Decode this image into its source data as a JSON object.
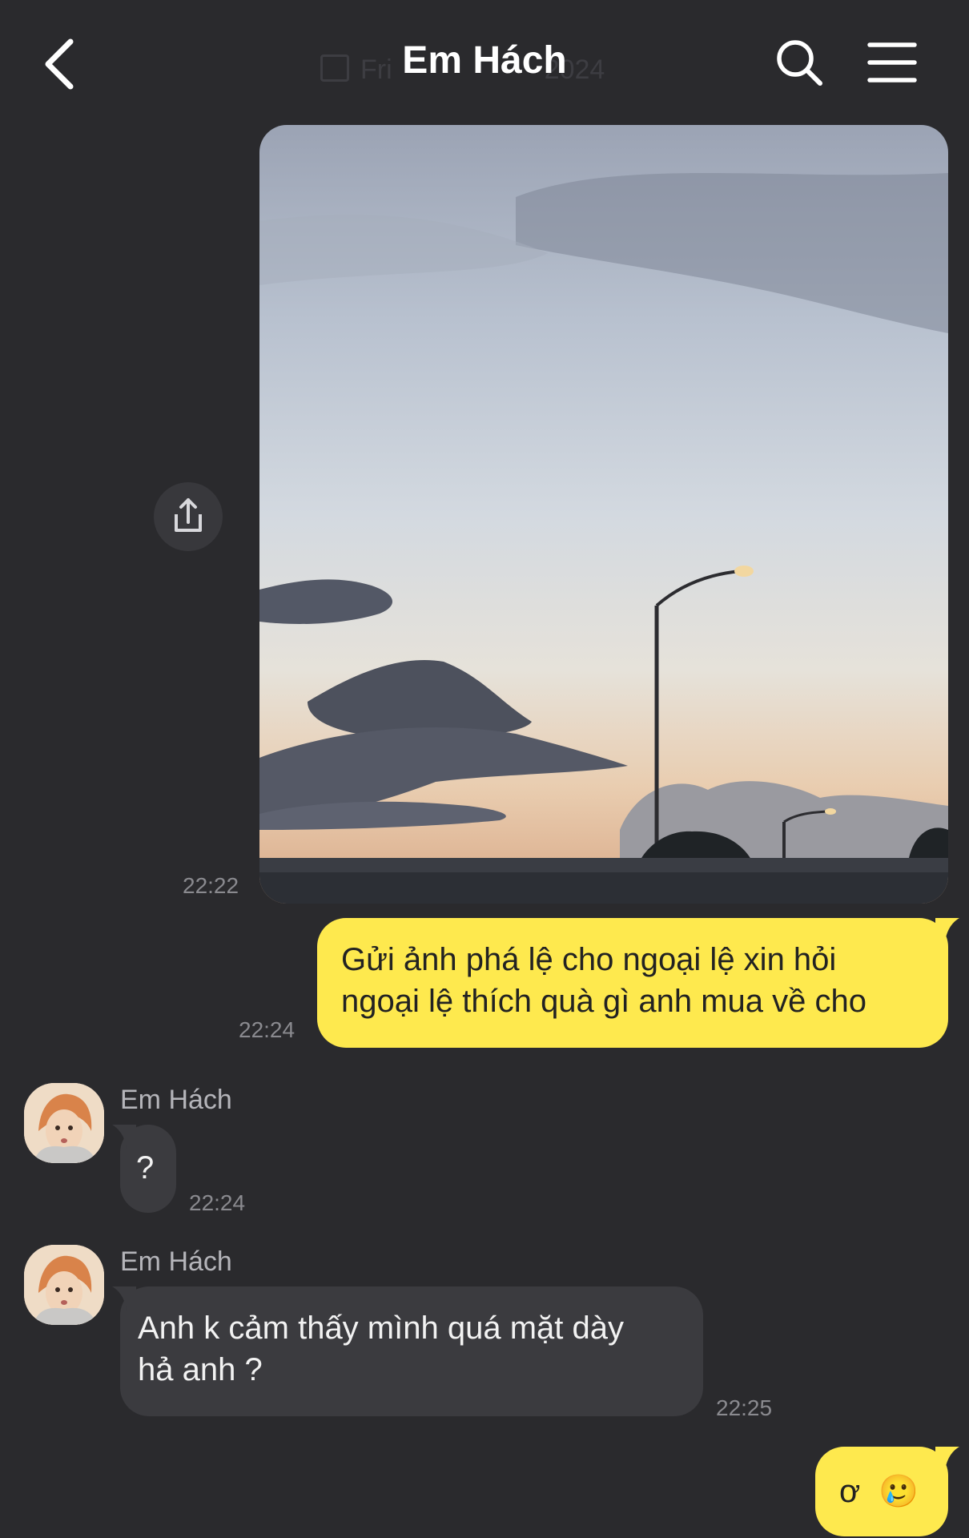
{
  "header": {
    "title": "Em Hách",
    "ghost_date": "Fri",
    "ghost_year": "2024",
    "back_icon": "chevron-left-icon",
    "search_icon": "search-icon",
    "menu_icon": "hamburger-menu-icon"
  },
  "messages": [
    {
      "type": "photo",
      "time": "22:22",
      "share_icon": "share-icon"
    },
    {
      "type": "text",
      "side": "right",
      "lines": [
        "Gửi ảnh phá lệ cho ngoại lệ xin hỏi",
        "ngoại lệ thích quà gì anh mua về cho"
      ],
      "time": "22:24"
    },
    {
      "type": "text",
      "side": "left",
      "sender": "Em Hách",
      "text": "?",
      "time": "22:24"
    },
    {
      "type": "text",
      "side": "left",
      "sender": "Em Hách",
      "lines": [
        "Anh k cảm thấy mình quá mặt dày",
        "hả anh ?"
      ],
      "time": "22:25"
    },
    {
      "type": "text",
      "side": "right",
      "text": "ơ",
      "emoji": "🥲"
    }
  ],
  "colors": {
    "background": "#2a2a2d",
    "outgoing_bubble": "#fee94e",
    "incoming_bubble": "#3b3b3f"
  }
}
